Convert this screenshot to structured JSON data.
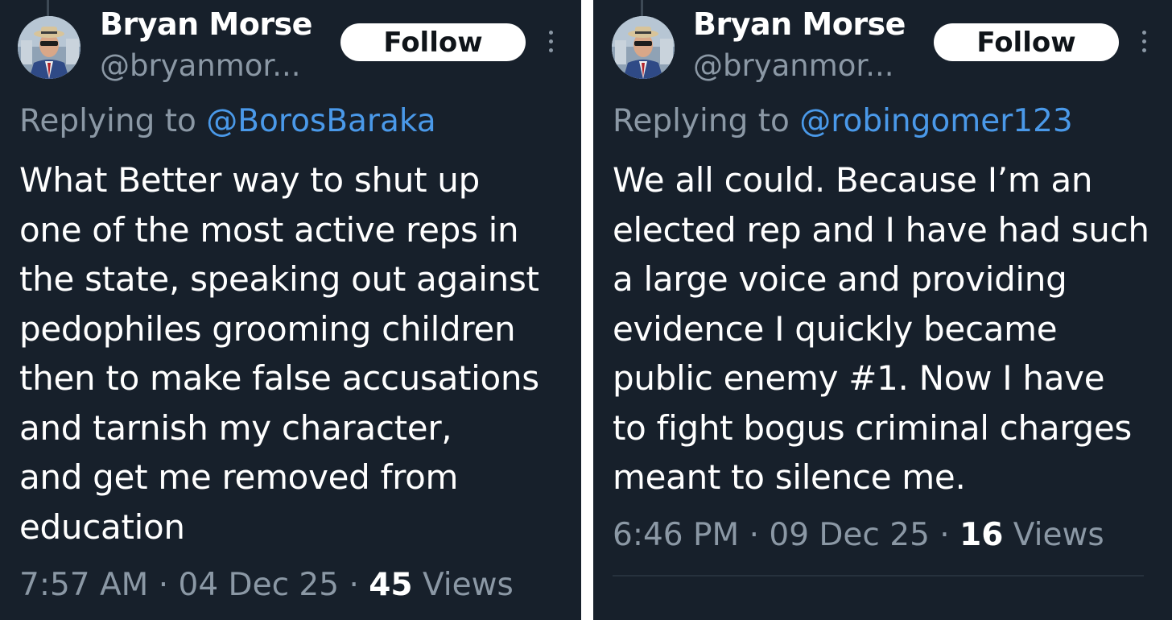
{
  "tweets": [
    {
      "author_name": "Bryan Morse",
      "author_handle": "@bryanmor...",
      "follow_label": "Follow",
      "replying_prefix": "Replying to",
      "replying_to": "@BorosBaraka",
      "body_lines": [
        "What Better way to shut up",
        "one of the most active reps in",
        "the state, speaking out against",
        "pedophiles grooming children",
        "then to make false accusations",
        "and tarnish my character,",
        "and get me removed from",
        "education"
      ],
      "time": "7:57 AM",
      "date": "04 Dec 25",
      "separator": "·",
      "views_count": "45",
      "views_label": "Views"
    },
    {
      "author_name": "Bryan Morse",
      "author_handle": "@bryanmor...",
      "follow_label": "Follow",
      "replying_prefix": "Replying to",
      "replying_to": "@robingomer123",
      "body_lines": [
        "We all could. Because I’m an",
        "elected rep and I have had such",
        "a large voice and providing",
        "evidence I quickly became",
        "public enemy #1. Now I have",
        "to fight bogus criminal charges",
        "meant to silence me."
      ],
      "time": "6:46 PM",
      "date": "09 Dec 25",
      "separator": "·",
      "views_count": "16",
      "views_label": "Views"
    }
  ],
  "colors": {
    "background": "#17202b",
    "text_primary": "#ffffff",
    "text_secondary": "#8b98a5",
    "mention": "#4a99e9",
    "divider": "#ffffff"
  },
  "icons": {
    "more": "vertical-ellipsis-icon",
    "avatar": "profile-photo"
  }
}
